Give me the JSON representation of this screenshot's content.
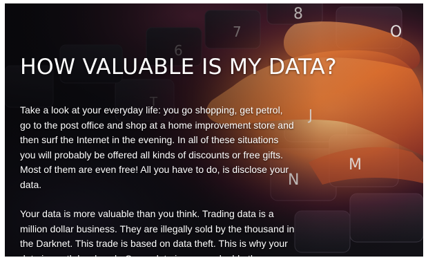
{
  "article": {
    "title": "HOW VALUABLE IS MY DATA?",
    "paragraphs": [
      "Take a look at your everyday life: you go shopping, get petrol, go to the post office and shop at a home improvement store and then surf the Internet in the evening. In all of these situations you will probably be offered all kinds of discounts or free gifts. Most of them are even free! All you have to do, is disclose your data.",
      "Your data is more valuable than you think. Trading data is a million dollar business. They are illegally sold by the thousand in the Darknet. This trade is based on data theft. This is why your data is worth hard cash. Some data is more valuable than"
    ]
  },
  "hero_image": {
    "keys": [
      "8",
      "7",
      "6",
      "O",
      "T",
      "J",
      "N",
      "M"
    ]
  }
}
